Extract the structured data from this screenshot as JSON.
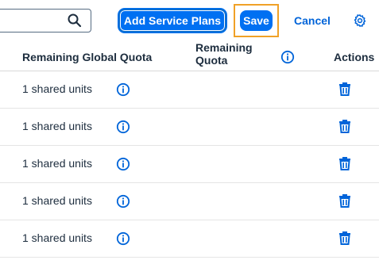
{
  "toolbar": {
    "search": {
      "value": "",
      "placeholder": ""
    },
    "add_service_plans_label": "Add Service Plans",
    "save_label": "Save",
    "cancel_label": "Cancel",
    "icons": {
      "search": "search-icon",
      "settings": "gear-icon"
    },
    "colors": {
      "primary": "#0070f2",
      "focus_outline": "#f0a127",
      "link": "#0064d9"
    }
  },
  "table": {
    "columns": {
      "remaining_global_quota": "Remaining Global Quota",
      "remaining_quota": "Remaining\nQuota",
      "actions": "Actions"
    },
    "rows": [
      {
        "remaining_global_quota": "1 shared units"
      },
      {
        "remaining_global_quota": "1 shared units"
      },
      {
        "remaining_global_quota": "1 shared units"
      },
      {
        "remaining_global_quota": "1 shared units"
      },
      {
        "remaining_global_quota": "1 shared units"
      }
    ],
    "icons": {
      "info": "info-icon",
      "delete": "delete-icon"
    }
  }
}
